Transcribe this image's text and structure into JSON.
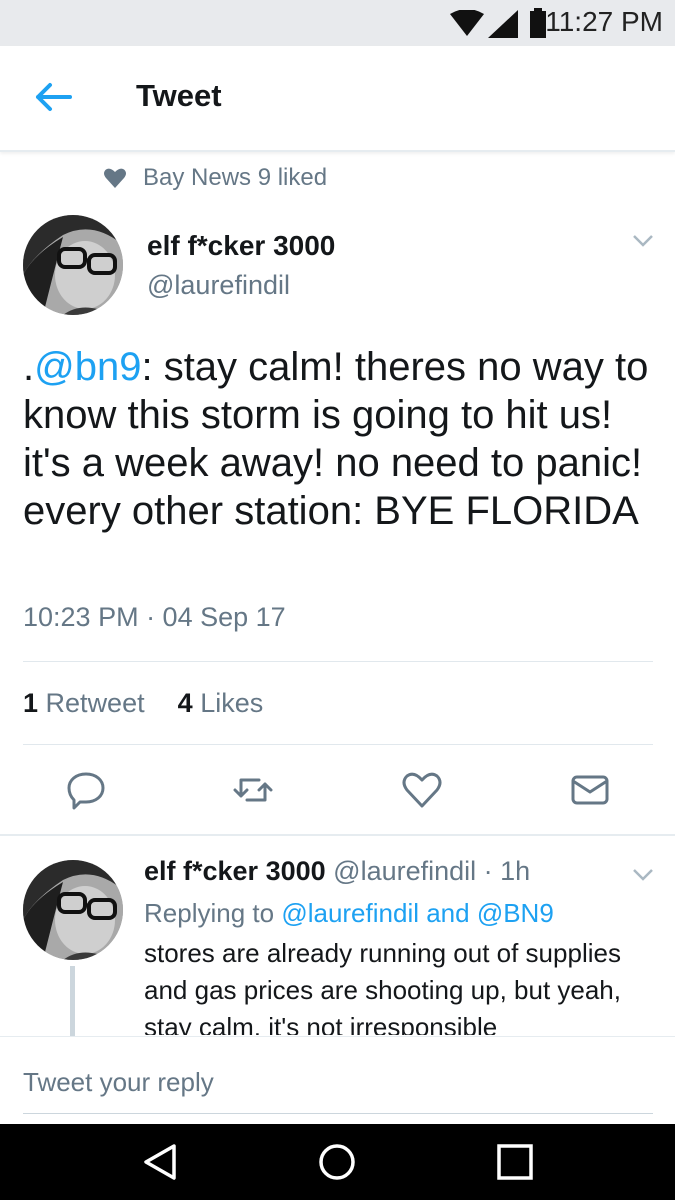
{
  "status_bar": {
    "time": "11:27 PM",
    "icons": [
      "wifi-icon",
      "signal-icon",
      "battery-icon"
    ]
  },
  "header": {
    "title": "Tweet",
    "back_icon": "back-arrow-icon"
  },
  "social_context": {
    "text": "Bay News 9 liked",
    "icon": "heart-icon"
  },
  "tweet": {
    "display_name": "elf f*cker 3000",
    "handle": "@laurefindil",
    "text_prefix": ".",
    "mention": "@bn9",
    "text_rest": ": stay calm! theres no way to know this storm is going to hit us! it's a week away! no need to panic!",
    "text_line2": "every other station: BYE FLORIDA",
    "timestamp": "10:23 PM · 04 Sep 17",
    "retweet_count": "1",
    "retweet_label": "Retweet",
    "like_count": "4",
    "like_label": "Likes",
    "actions": [
      "reply-icon",
      "retweet-icon",
      "like-icon",
      "dm-icon"
    ]
  },
  "reply": {
    "display_name": "elf f*cker 3000",
    "handle": "@laurefindil",
    "time": "· 1h",
    "replying_to_prefix": "Replying to",
    "replying_to_users": "@laurefindil and @BN9",
    "text": "stores are already running out of supplies and gas prices are shooting up, but yeah, stay calm, it's not irresponsible"
  },
  "compose": {
    "placeholder": "Tweet your reply"
  },
  "colors": {
    "accent": "#1da1f2",
    "secondary_text": "#657786",
    "divider": "#e1e8ed"
  }
}
